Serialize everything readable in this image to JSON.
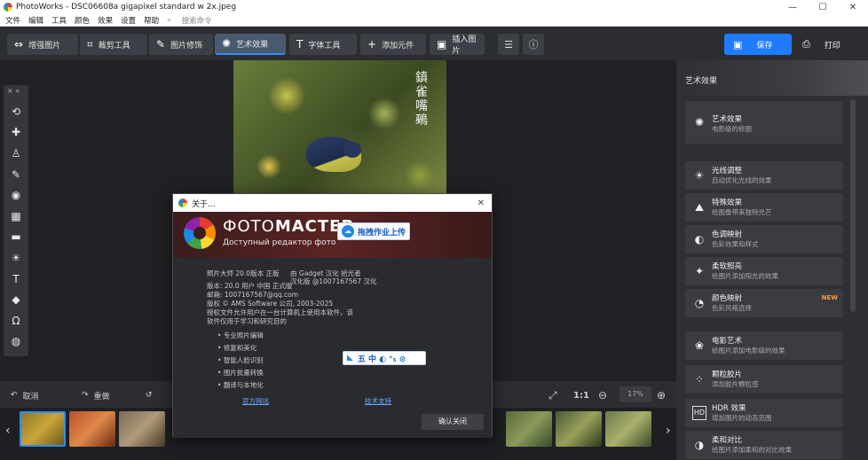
{
  "window": {
    "title": "PhotoWorks - DSC06608a gigapixel standard w 2x.jpeg",
    "controls": [
      "—",
      "☐",
      "✕"
    ]
  },
  "menu": {
    "items": [
      "文件",
      "编辑",
      "工具",
      "颜色",
      "效果",
      "设置",
      "帮助"
    ],
    "search_placeholder": "搜索命令"
  },
  "toolbar": {
    "tabs": [
      {
        "icon": "⇔",
        "label": "增强图片"
      },
      {
        "icon": "⌗",
        "label": "裁剪工具"
      },
      {
        "icon": "✎",
        "label": "图片修饰"
      },
      {
        "icon": "✺",
        "label": "艺术效果"
      },
      {
        "icon": "T",
        "label": "字体工具"
      },
      {
        "icon": "+",
        "label": "添加元件"
      }
    ],
    "extra_tab": {
      "icon": "▣",
      "label": "插入图片"
    },
    "save_label": "保存",
    "print_label": "打印"
  },
  "left_tools": {
    "header": "× «",
    "items": [
      "⟲",
      "✚",
      "♙",
      "✎",
      "◉",
      "▦",
      "▬",
      "☀",
      "T",
      "◆",
      "Ω",
      "◍"
    ]
  },
  "photo": {
    "calligraphy": "鎮雀嘴鵐"
  },
  "bottom_bar": {
    "undo_label": "取消",
    "redo_label": "重做",
    "fit_label": "⤢",
    "ratio_label": "1:1",
    "zoom_value": "17%"
  },
  "right_panel": {
    "title": "艺术效果",
    "cards": [
      {
        "icon": "✺",
        "title": "艺术效果",
        "sub": "电影级的修图"
      },
      {
        "icon": "☀",
        "title": "光线调整",
        "sub": "自动优化光线的效果"
      },
      {
        "icon": "⛰",
        "title": "特殊效果",
        "sub": "给图像带来独特光芒"
      },
      {
        "icon": "◐",
        "title": "色调映射",
        "sub": "色彩效果和样式"
      },
      {
        "icon": "✦",
        "title": "柔软照亮",
        "sub": "给图片添加阳光的效果"
      },
      {
        "icon": "◔",
        "title": "颜色映射",
        "sub": "色彩风格选择",
        "badge": "NEW"
      },
      {
        "icon": "❀",
        "title": "电影艺术",
        "sub": "给图片添加电影级的效果"
      },
      {
        "icon": "⁘",
        "title": "颗粒胶片",
        "sub": "添加胶片颗粒感"
      },
      {
        "icon": "HD",
        "title": "HDR 效果",
        "sub": "增加图片的动态范围"
      },
      {
        "icon": "◑",
        "title": "柔和对比",
        "sub": "给图片添加柔和的对比效果"
      }
    ]
  },
  "dialog": {
    "title": "关于...",
    "brand_part1": "ФОТО",
    "brand_part2": "МАСТЕР",
    "tagline": "Доступный редактор фото",
    "lines": [
      "照片大师 20.0版本 正版",
      "版本: 20.0 用户 中国 正式版",
      "邮箱: 1007167567@qq.com",
      "版权 © AMS Software 公司, 2003-2025",
      "授权文件允许用户在一台计算机上使用本软件，该",
      "软件仅用于学习和研究目的"
    ],
    "right_lines": [
      "由 Gadget 汉化 拾光者",
      "汉化版 @1007167567 汉化"
    ],
    "bullets": [
      "专业照片编辑",
      "修复和美化",
      "智能人脸识别",
      "图片批量转换",
      "翻译与本地化"
    ],
    "link_site": "官方网站",
    "link_support": "技术支持",
    "ok_label": "确认关闭"
  },
  "ime": {
    "badge_text": "拖拽作业上传",
    "bar_text": "五 中 ◐ °₅ ⊙"
  },
  "colors": {
    "accent": "#1f7bff",
    "badge_new": "#ff9a3c",
    "dialog_banner": "#5a2424"
  }
}
